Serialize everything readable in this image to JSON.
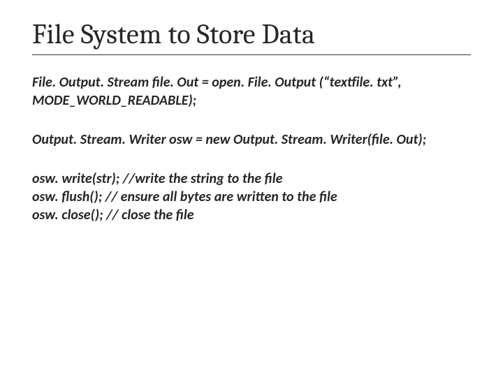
{
  "title": "File System to Store Data",
  "paragraphs": [
    "File. Output. Stream  file. Out = open. File. Output (“textfile. txt”, MODE_WORLD_READABLE);",
    "Output. Stream. Writer osw = new Output. Stream. Writer(file. Out);",
    "osw. write(str); //write the string to the file\nosw. flush();     // ensure all bytes are written to the file\nosw. close();    // close the file"
  ]
}
